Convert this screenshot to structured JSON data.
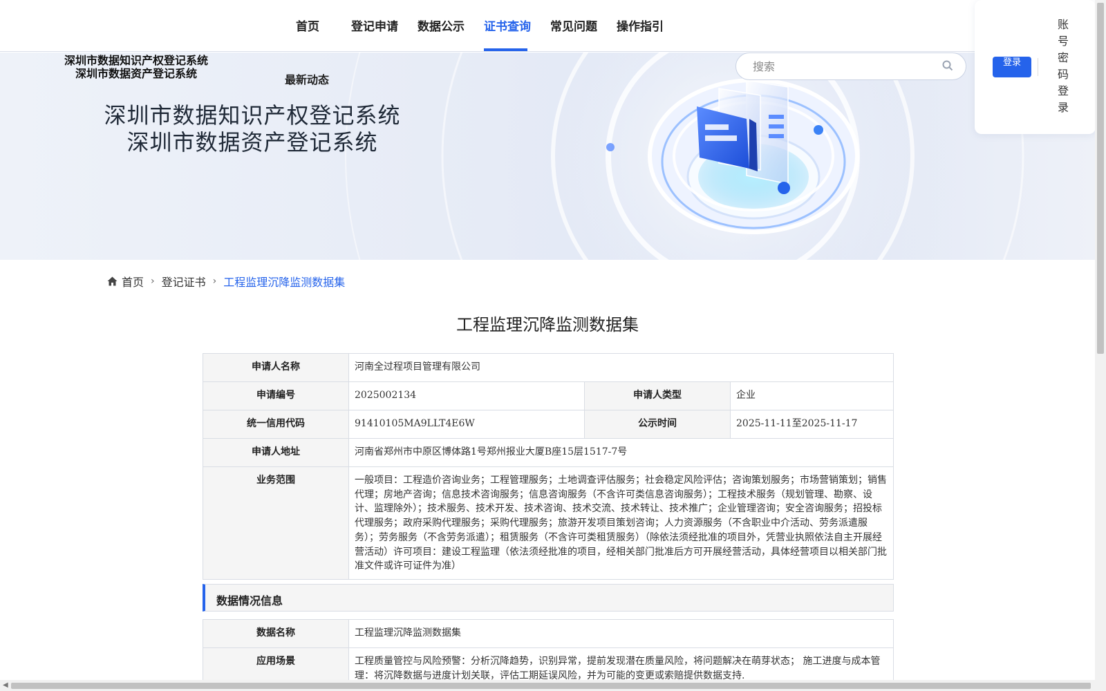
{
  "nav": {
    "items": [
      {
        "label": "首页"
      },
      {
        "label": "登记申请"
      },
      {
        "label": "数据公示"
      },
      {
        "label": "证书查询"
      },
      {
        "label": "常见问题"
      },
      {
        "label": "操作指引"
      }
    ],
    "active_index": 3
  },
  "header": {
    "logo_line1": "深圳市数据知识产权登记系统",
    "logo_line2": "深圳市数据资产登记系统",
    "news_link": "最新动态"
  },
  "banner": {
    "title_line1": "深圳市数据知识产权登记系统",
    "title_line2": "深圳市数据资产登记系统"
  },
  "search": {
    "placeholder": "搜索",
    "icon": "search-icon"
  },
  "login": {
    "button_label": "登录",
    "password_login": "账号密码登录"
  },
  "breadcrumb": {
    "home": "首页",
    "level1": "登记证书",
    "current": "工程监理沉降监测数据集",
    "home_icon": "home-icon"
  },
  "page_title": "工程监理沉降监测数据集",
  "applicant": {
    "name_label": "申请人名称",
    "name": "河南全过程项目管理有限公司",
    "number_label": "申请编号",
    "number": "2025002134",
    "type_label": "申请人类型",
    "type": "企业",
    "credit_label": "统一信用代码",
    "credit_code": "91410105MA9LLT4E6W",
    "publicity_label": "公示时间",
    "publicity_time": "2025-11-11至2025-11-17",
    "address_label": "申请人地址",
    "address": "河南省郑州市中原区博体路1号郑州报业大厦B座15层1517-7号",
    "scope_label": "业务范围",
    "scope": "一般项目：工程造价咨询业务；工程管理服务；土地调查评估服务；社会稳定风险评估；咨询策划服务；市场营销策划；销售代理；房地产咨询；信息技术咨询服务；信息咨询服务（不含许可类信息咨询服务）；工程技术服务（规划管理、勘察、设计、监理除外）；技术服务、技术开发、技术咨询、技术交流、技术转让、技术推广；企业管理咨询；安全咨询服务；招投标代理服务；政府采购代理服务；采购代理服务；旅游开发项目策划咨询；人力资源服务（不含职业中介活动、劳务派遣服务）；劳务服务（不含劳务派遣）；租赁服务（不含许可类租赁服务）（除依法须经批准的项目外，凭营业执照依法自主开展经营活动）许可项目：建设工程监理（依法须经批准的项目，经相关部门批准后方可开展经营活动，具体经营项目以相关部门批准文件或许可证件为准）"
  },
  "data_section": {
    "heading": "数据情况信息",
    "name_label": "数据名称",
    "name": "工程监理沉降监测数据集",
    "scenario_label": "应用场景",
    "scenario": "工程质量管控与风险预警：分析沉降趋势，识别异常，提前发现潜在质量风险，将问题解决在萌芽状态； 施工进度与成本管理：将沉降数据与进度计划关联，评估工期延误风险，并为可能的变更或索赔提供数据支持."
  },
  "colors": {
    "accent": "#2563eb",
    "label_bg": "#f5f5f5",
    "border": "#d9dde4"
  }
}
